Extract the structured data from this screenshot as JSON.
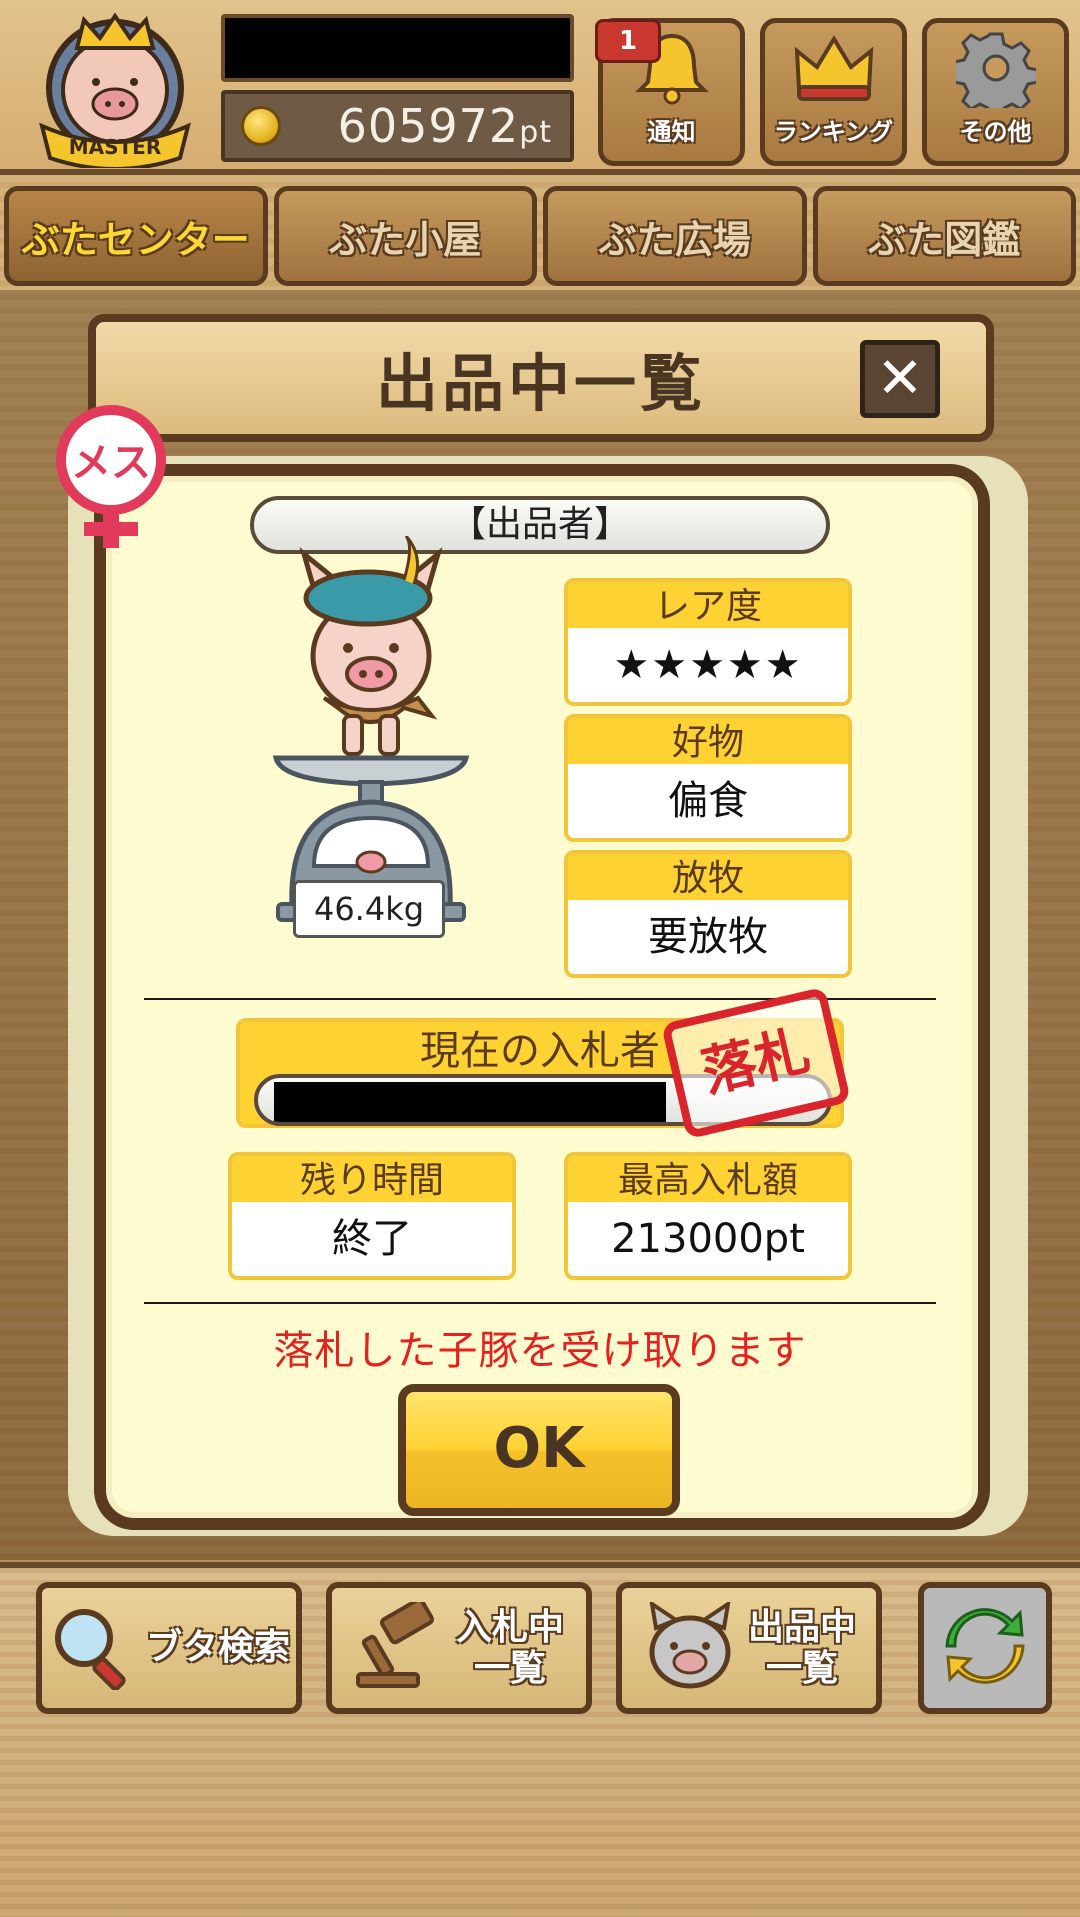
{
  "header": {
    "badge_text": "MASTER",
    "points_value": "605972",
    "points_unit": "pt",
    "buttons": [
      {
        "label": "通知",
        "badge": "1"
      },
      {
        "label": "ランキング"
      },
      {
        "label": "その他"
      }
    ]
  },
  "tabs": [
    {
      "label": "ぶたセンター",
      "active": true
    },
    {
      "label": "ぶた小屋"
    },
    {
      "label": "ぶた広場"
    },
    {
      "label": "ぶた図鑑"
    }
  ],
  "popup": {
    "title": "出品中一覧",
    "gender_badge": "メス",
    "seller_label": "【出品者】",
    "weight": "46.4kg",
    "rarity": {
      "label": "レア度",
      "stars": "★★★★★",
      "count": 5
    },
    "favorite": {
      "label": "好物",
      "value": "偏食"
    },
    "grazing": {
      "label": "放牧",
      "value": "要放牧"
    },
    "current_bidder_label": "現在の入札者",
    "stamp": "落札",
    "remaining_time": {
      "label": "残り時間",
      "value": "終了"
    },
    "highest_bid": {
      "label": "最高入札額",
      "value": "213000pt"
    },
    "message": "落札した子豚を受け取ります",
    "ok_label": "OK"
  },
  "bottom_bar": {
    "search": "ブタ検索",
    "bidding_list": [
      "入札中",
      "一覧"
    ],
    "listing_list": [
      "出品中",
      "一覧"
    ]
  },
  "colors": {
    "wood": "#c9a36b",
    "dark_brown": "#5a3b1f",
    "yellow_header": "#ffd233",
    "panel_bg": "#fffbd1",
    "message_red": "#e5211e",
    "stamp_red": "#d9242c",
    "star_pink": "#ea7a7a"
  }
}
